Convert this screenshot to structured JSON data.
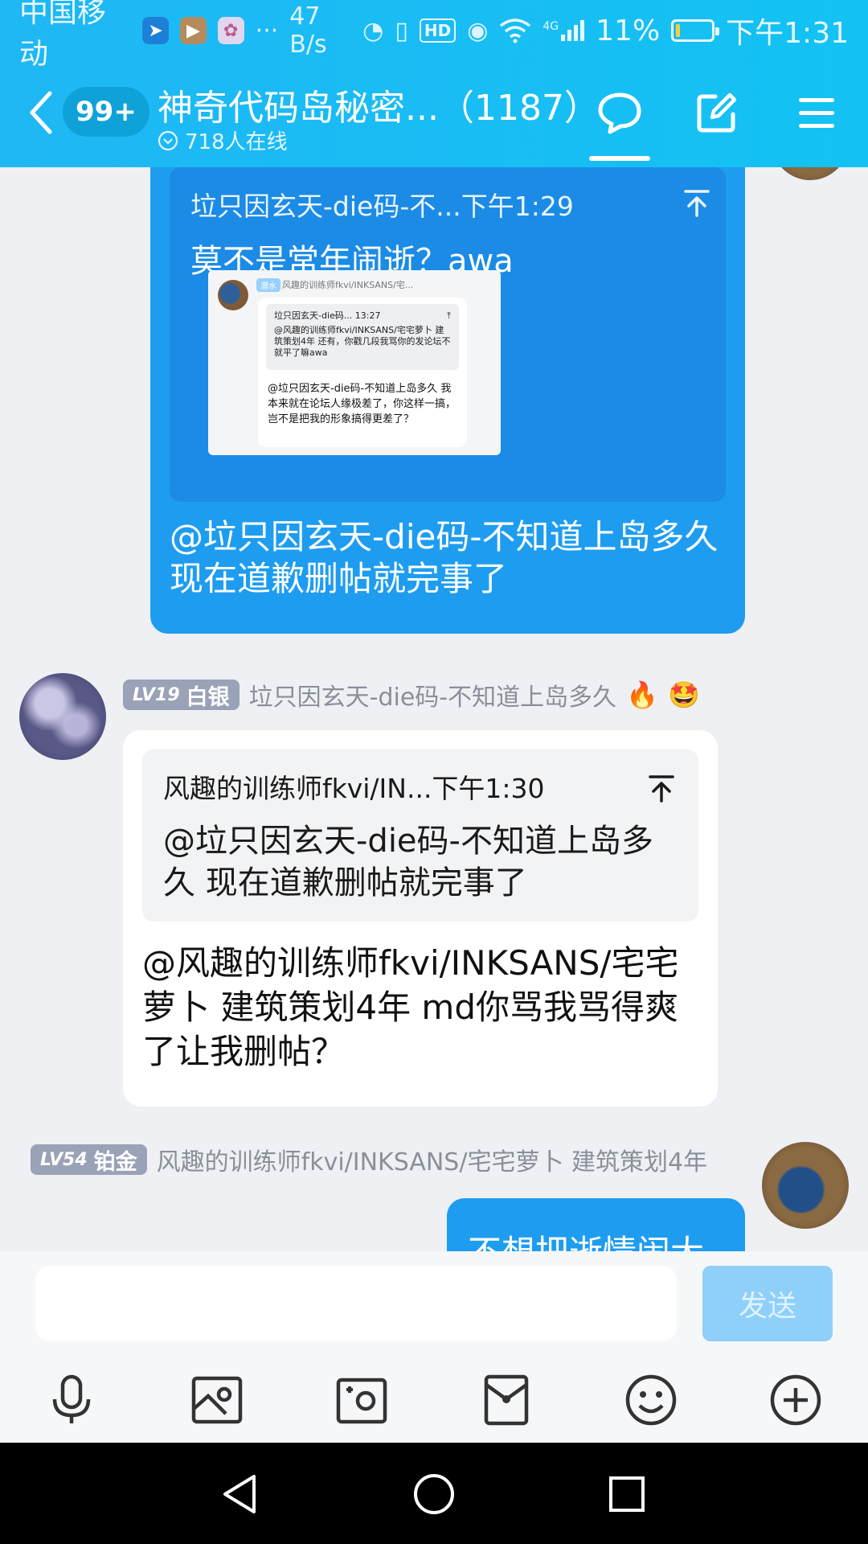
{
  "status_bar": {
    "carrier": "中国移动",
    "speed": "47 B/s",
    "hd": "HD",
    "signal": "4G",
    "battery_percent": "11%",
    "battery_level": 0.11,
    "time": "下午1:31",
    "more": "···"
  },
  "header": {
    "unread_badge": "99+",
    "title": "神奇代码岛秘密...（1187）",
    "online": "718人在线"
  },
  "messages": {
    "outgoing_1": {
      "quote_meta": "垃只因玄天-die码-不...下午1:29",
      "quote_text": "莫不是常年闹逝？awa",
      "thumb": {
        "tag": "潜水",
        "name": "风趣的训练师fkvi/INKSANS/宅...",
        "quote_meta": "垃只因玄天-die码... 13:27",
        "quote_text": "@风趣的训练师fkvi/INKSANS/宅宅萝卜 建筑策划4年 还有，你戳几段我骂你的发论坛不就平了嘛awa",
        "body": "@垃只因玄天-die码-不知道上岛多久 我本来就在论坛人缘极差了，你这样一搞，岂不是把我的形象搞得更差了？"
      },
      "body": "@垃只因玄天-die码-不知道上岛多久 现在道歉删帖就完事了"
    },
    "incoming_1": {
      "level": "LV19",
      "rank": "白银",
      "sender": "垃只因玄天-die码-不知道上岛多久",
      "emoji_1": "🔥",
      "emoji_2": "🤩",
      "quote_meta": "风趣的训练师fkvi/IN...下午1:30",
      "quote_text": "@垃只因玄天-die码-不知道上岛多久 现在道歉删帖就完事了",
      "body": "@风趣的训练师fkvi/INKSANS/宅宅萝卜 建筑策划4年 md你骂我骂得爽了让我删帖？"
    },
    "outgoing_2": {
      "level": "LV54",
      "rank": "铂金",
      "sender": "风趣的训练师fkvi/INKSANS/宅宅萝卜 建筑策划4年",
      "body": "不想把逝情闹大"
    }
  },
  "input": {
    "placeholder": "",
    "send_label": "发送"
  },
  "toolbar": {
    "items": [
      "microphone-icon",
      "image-icon",
      "camera-icon",
      "red-packet-icon",
      "emoji-icon",
      "plus-icon"
    ]
  },
  "colors": {
    "header": "#13c2f3",
    "outgoing_bubble": "#1e9df0",
    "send_disabled": "#8fd0fb"
  }
}
